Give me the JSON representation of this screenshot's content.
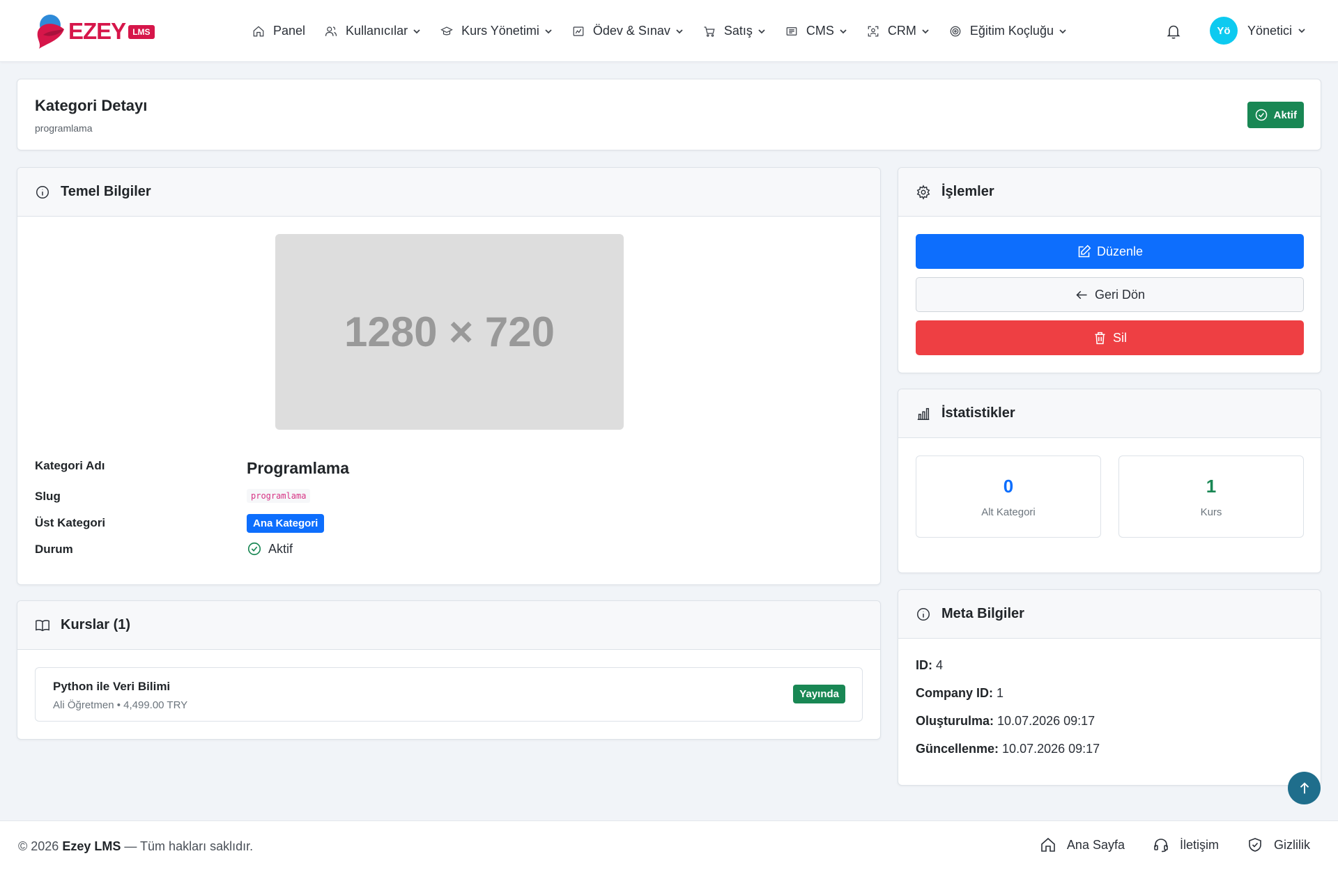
{
  "brand": {
    "name": "EZEY",
    "badge": "LMS"
  },
  "nav": [
    {
      "label": "Panel",
      "icon": "home-icon",
      "dropdown": false
    },
    {
      "label": "Kullanıcılar",
      "icon": "users-icon",
      "dropdown": true
    },
    {
      "label": "Kurs Yönetimi",
      "icon": "graduation-cap-icon",
      "dropdown": true
    },
    {
      "label": "Ödev & Sınav",
      "icon": "chart-board-icon",
      "dropdown": true
    },
    {
      "label": "Satış",
      "icon": "cart-icon",
      "dropdown": true
    },
    {
      "label": "CMS",
      "icon": "newspaper-icon",
      "dropdown": true
    },
    {
      "label": "CRM",
      "icon": "person-scan-icon",
      "dropdown": true
    },
    {
      "label": "Eğitim Koçluğu",
      "icon": "target-icon",
      "dropdown": true
    }
  ],
  "user": {
    "initials": "Yö",
    "name": "Yönetici"
  },
  "page": {
    "title": "Kategori Detayı",
    "subtitle": "programlama",
    "status_badge": "Aktif"
  },
  "basic_info": {
    "title": "Temel Bilgiler",
    "image_placeholder": "1280 × 720",
    "labels": {
      "name": "Kategori Adı",
      "slug": "Slug",
      "parent": "Üst Kategori",
      "status": "Durum"
    },
    "values": {
      "name": "Programlama",
      "slug": "programlama",
      "parent": "Ana Kategori",
      "status": "Aktif"
    }
  },
  "courses": {
    "title": "Kurslar (1)",
    "items": [
      {
        "title": "Python ile Veri Bilimi",
        "meta": "Ali Öğretmen • 4,499.00 TRY",
        "status": "Yayında"
      }
    ]
  },
  "actions": {
    "title": "İşlemler",
    "edit": "Düzenle",
    "back": "Geri Dön",
    "delete": "Sil"
  },
  "stats": {
    "title": "İstatistikler",
    "items": [
      {
        "value": "0",
        "label": "Alt Kategori",
        "color": "#0d6efd"
      },
      {
        "value": "1",
        "label": "Kurs",
        "color": "#198754"
      }
    ]
  },
  "meta": {
    "title": "Meta Bilgiler",
    "rows": [
      {
        "label": "ID:",
        "value": "4"
      },
      {
        "label": "Company ID:",
        "value": "1"
      },
      {
        "label": "Oluşturulma:",
        "value": "10.07.2026 09:17"
      },
      {
        "label": "Güncellenme:",
        "value": "10.07.2026 09:17"
      }
    ]
  },
  "footer": {
    "copyright": "© 2026",
    "brand": "Ezey LMS",
    "rights": "— Tüm hakları saklıdır.",
    "links": [
      {
        "label": "Ana Sayfa",
        "icon": "home-icon"
      },
      {
        "label": "İletişim",
        "icon": "headset-icon"
      },
      {
        "label": "Gizlilik",
        "icon": "shield-check-icon"
      }
    ]
  }
}
